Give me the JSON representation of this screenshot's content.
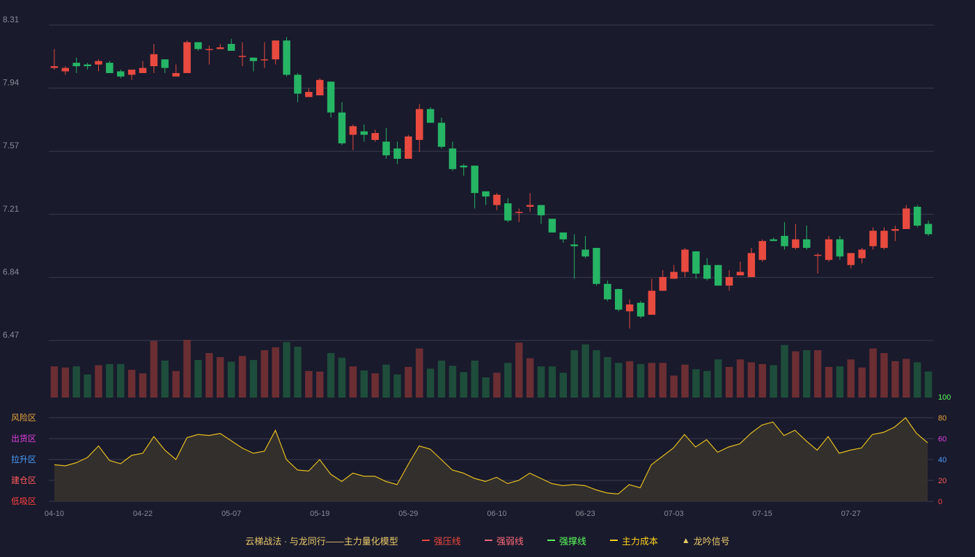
{
  "legend": {
    "title": "云梯战法 · 与龙同行——主力量化模型",
    "items": [
      {
        "label": "强压线",
        "color": "#f0483c",
        "style": "solid"
      },
      {
        "label": "强弱线",
        "color": "#ff6b7a",
        "style": "dashed"
      },
      {
        "label": "强撑线",
        "color": "#5cff5c",
        "style": "solid"
      },
      {
        "label": "主力成本",
        "color": "#ffd21f",
        "style": "dashed"
      },
      {
        "label": "龙吟信号",
        "color": "#e8c96a",
        "style": "triangle"
      }
    ]
  },
  "zones": [
    {
      "label": "风险区",
      "color": "#e8a73c"
    },
    {
      "label": "出货区",
      "color": "#e040e0"
    },
    {
      "label": "拉升区",
      "color": "#4aa0ff"
    },
    {
      "label": "建仓区",
      "color": "#ff5a5a"
    },
    {
      "label": "低吸区",
      "color": "#ff4040"
    }
  ],
  "colors": {
    "background": "#191a2c",
    "up": "#e84a3f",
    "down": "#26b565",
    "vol_up": "#6b2e33",
    "vol_down": "#1e4d3b",
    "indicator_line": "#e8c020",
    "indicator_fill": "#35302c",
    "grid": "#3a3c4f",
    "axis_text": "#8a8c98"
  },
  "chart_data": {
    "type": "candlestick",
    "price_axis": {
      "ticks": [
        "8.31",
        "7.94",
        "7.57",
        "7.21",
        "6.84",
        "6.47"
      ],
      "ylim": [
        6.47,
        8.31
      ]
    },
    "indicator_axis": {
      "ticks": [
        "100",
        "80",
        "60",
        "40",
        "20",
        "0"
      ],
      "tick_colors": [
        "#5cff5c",
        "#e8a73c",
        "#e040e0",
        "#4aa0ff",
        "#ff5a5a",
        "#ff4040"
      ],
      "ylim": [
        0,
        100
      ]
    },
    "x_ticks": [
      {
        "index": 0,
        "label": "04-10"
      },
      {
        "index": 8,
        "label": "04-22"
      },
      {
        "index": 16,
        "label": "05-07"
      },
      {
        "index": 24,
        "label": "05-19"
      },
      {
        "index": 32,
        "label": "05-29"
      },
      {
        "index": 40,
        "label": "06-10"
      },
      {
        "index": 48,
        "label": "06-23"
      },
      {
        "index": 56,
        "label": "07-03"
      },
      {
        "index": 64,
        "label": "07-15"
      },
      {
        "index": 72,
        "label": "07-27"
      }
    ],
    "ohlc": [
      [
        8.06,
        8.07,
        8.17,
        8.05
      ],
      [
        8.04,
        8.06,
        8.07,
        8.02
      ],
      [
        8.09,
        8.07,
        8.12,
        8.03
      ],
      [
        8.08,
        8.07,
        8.09,
        8.05
      ],
      [
        8.08,
        8.1,
        8.11,
        8.04
      ],
      [
        8.09,
        8.03,
        8.1,
        8.03
      ],
      [
        8.04,
        8.01,
        8.05,
        8.0
      ],
      [
        8.02,
        8.05,
        8.05,
        7.99
      ],
      [
        8.03,
        8.06,
        8.1,
        8.03
      ],
      [
        8.07,
        8.14,
        8.2,
        8.03
      ],
      [
        8.11,
        8.06,
        8.11,
        8.03
      ],
      [
        8.01,
        8.03,
        8.08,
        8.01
      ],
      [
        8.03,
        8.21,
        8.22,
        8.03
      ],
      [
        8.21,
        8.17,
        8.21,
        8.16
      ],
      [
        8.17,
        8.17,
        8.19,
        8.08
      ],
      [
        8.17,
        8.18,
        8.2,
        8.17
      ],
      [
        8.2,
        8.16,
        8.23,
        8.16
      ],
      [
        8.13,
        8.13,
        8.21,
        8.07
      ],
      [
        8.12,
        8.1,
        8.12,
        8.04
      ],
      [
        8.11,
        8.11,
        8.21,
        8.06
      ],
      [
        8.11,
        8.22,
        8.22,
        8.08
      ],
      [
        8.22,
        8.02,
        8.24,
        8.01
      ],
      [
        8.02,
        7.91,
        8.03,
        7.86
      ],
      [
        7.89,
        7.92,
        7.94,
        7.89
      ],
      [
        7.9,
        7.99,
        8.0,
        7.9
      ],
      [
        7.98,
        7.8,
        7.98,
        7.77
      ],
      [
        7.8,
        7.62,
        7.86,
        7.61
      ],
      [
        7.67,
        7.72,
        7.73,
        7.58
      ],
      [
        7.69,
        7.67,
        7.73,
        7.63
      ],
      [
        7.64,
        7.68,
        7.7,
        7.63
      ],
      [
        7.63,
        7.55,
        7.71,
        7.53
      ],
      [
        7.59,
        7.53,
        7.63,
        7.5
      ],
      [
        7.53,
        7.66,
        7.67,
        7.53
      ],
      [
        7.64,
        7.82,
        7.85,
        7.57
      ],
      [
        7.82,
        7.74,
        7.83,
        7.74
      ],
      [
        7.74,
        7.6,
        7.77,
        7.59
      ],
      [
        7.59,
        7.47,
        7.63,
        7.46
      ],
      [
        7.49,
        7.48,
        7.5,
        7.43
      ],
      [
        7.49,
        7.33,
        7.49,
        7.24
      ],
      [
        7.34,
        7.31,
        7.34,
        7.26
      ],
      [
        7.26,
        7.32,
        7.33,
        7.23
      ],
      [
        7.27,
        7.17,
        7.3,
        7.16
      ],
      [
        7.22,
        7.22,
        7.24,
        7.16
      ],
      [
        7.25,
        7.26,
        7.33,
        7.22
      ],
      [
        7.26,
        7.2,
        7.26,
        7.15
      ],
      [
        7.18,
        7.1,
        7.18,
        7.1
      ],
      [
        7.1,
        7.06,
        7.1,
        7.04
      ],
      [
        7.03,
        7.02,
        7.09,
        6.83
      ],
      [
        7.0,
        6.96,
        7.08,
        6.95
      ],
      [
        7.01,
        6.8,
        7.01,
        6.79
      ],
      [
        6.8,
        6.71,
        6.82,
        6.7
      ],
      [
        6.77,
        6.65,
        6.77,
        6.64
      ],
      [
        6.64,
        6.68,
        6.71,
        6.54
      ],
      [
        6.69,
        6.61,
        6.7,
        6.6
      ],
      [
        6.62,
        6.76,
        6.83,
        6.62
      ],
      [
        6.76,
        6.84,
        6.88,
        6.76
      ],
      [
        6.83,
        6.87,
        6.91,
        6.83
      ],
      [
        6.87,
        7.0,
        7.01,
        6.84
      ],
      [
        6.99,
        6.86,
        6.99,
        6.83
      ],
      [
        6.91,
        6.83,
        6.95,
        6.82
      ],
      [
        6.91,
        6.79,
        6.91,
        6.79
      ],
      [
        6.79,
        6.84,
        6.88,
        6.76
      ],
      [
        6.85,
        6.87,
        6.93,
        6.85
      ],
      [
        6.84,
        6.98,
        7.01,
        6.84
      ],
      [
        6.94,
        7.05,
        7.06,
        6.93
      ],
      [
        7.06,
        7.05,
        7.07,
        7.05
      ],
      [
        7.08,
        7.02,
        7.16,
        7.0
      ],
      [
        7.01,
        7.06,
        7.15,
        7.0
      ],
      [
        7.06,
        7.01,
        7.14,
        7.0
      ],
      [
        6.97,
        6.97,
        6.98,
        6.86
      ],
      [
        6.94,
        7.06,
        7.08,
        6.93
      ],
      [
        7.06,
        6.96,
        7.08,
        6.94
      ],
      [
        6.91,
        6.98,
        6.98,
        6.89
      ],
      [
        6.95,
        7.0,
        7.01,
        6.92
      ],
      [
        7.02,
        7.11,
        7.13,
        7.0
      ],
      [
        7.01,
        7.11,
        7.13,
        7.0
      ],
      [
        7.11,
        7.12,
        7.14,
        7.05
      ],
      [
        7.12,
        7.24,
        7.26,
        7.12
      ],
      [
        7.25,
        7.14,
        7.26,
        7.13
      ],
      [
        7.15,
        7.09,
        7.17,
        7.08
      ]
    ],
    "volume": [
      0.54,
      0.52,
      0.54,
      0.4,
      0.56,
      0.58,
      0.58,
      0.48,
      0.42,
      0.98,
      0.64,
      0.46,
      1.0,
      0.65,
      0.77,
      0.7,
      0.62,
      0.72,
      0.65,
      0.82,
      0.87,
      0.96,
      0.88,
      0.46,
      0.45,
      0.77,
      0.69,
      0.54,
      0.47,
      0.42,
      0.57,
      0.4,
      0.53,
      0.85,
      0.5,
      0.64,
      0.55,
      0.44,
      0.64,
      0.35,
      0.43,
      0.6,
      0.95,
      0.68,
      0.54,
      0.54,
      0.43,
      0.82,
      0.92,
      0.82,
      0.7,
      0.6,
      0.63,
      0.58,
      0.6,
      0.6,
      0.38,
      0.57,
      0.49,
      0.46,
      0.66,
      0.53,
      0.66,
      0.61,
      0.58,
      0.56,
      0.91,
      0.8,
      0.82,
      0.82,
      0.53,
      0.54,
      0.66,
      0.52,
      0.85,
      0.77,
      0.63,
      0.67,
      0.61,
      0.45
    ],
    "indicator": [
      35,
      34,
      37,
      42,
      53,
      39,
      36,
      44,
      46,
      62,
      49,
      40,
      61,
      64,
      63,
      65,
      58,
      51,
      46,
      48,
      68,
      40,
      30,
      29,
      40,
      26,
      19,
      27,
      24,
      24,
      19,
      16,
      35,
      53,
      50,
      40,
      30,
      27,
      22,
      19,
      23,
      17,
      20,
      27,
      22,
      17,
      15,
      16,
      15,
      11,
      8,
      7,
      16,
      13,
      35,
      43,
      51,
      64,
      52,
      59,
      47,
      52,
      55,
      65,
      73,
      76,
      63,
      68,
      58,
      49,
      62,
      46,
      49,
      51,
      64,
      66,
      71,
      80,
      65,
      56
    ]
  }
}
